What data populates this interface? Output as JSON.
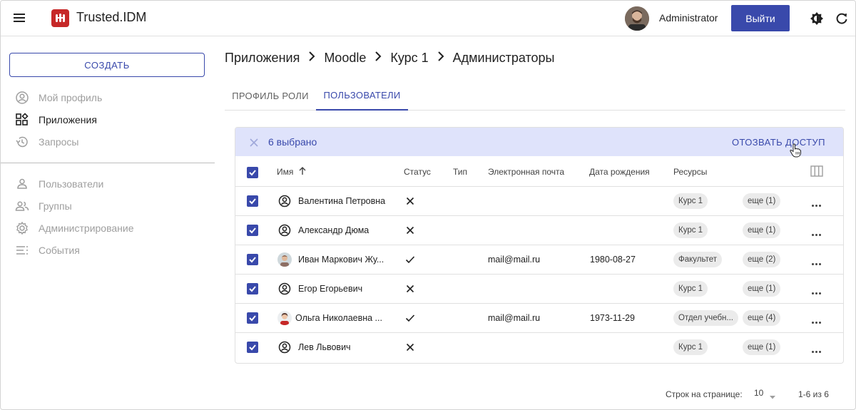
{
  "header": {
    "app_title": "Trusted.IDM",
    "user_name": "Administrator",
    "logout_label": "Выйти"
  },
  "sidebar": {
    "create_label": "СОЗДАТЬ",
    "items": [
      {
        "label": "Мой профиль",
        "icon": "account-circle-icon"
      },
      {
        "label": "Приложения",
        "icon": "apps-icon"
      },
      {
        "label": "Запросы",
        "icon": "history-icon"
      },
      {
        "label": "Пользователи",
        "icon": "person-icon"
      },
      {
        "label": "Группы",
        "icon": "group-icon"
      },
      {
        "label": "Администрирование",
        "icon": "gear-icon"
      },
      {
        "label": "События",
        "icon": "list-icon"
      }
    ]
  },
  "breadcrumb": [
    "Приложения",
    "Moodle",
    "Курс 1",
    "Администраторы"
  ],
  "tabs": [
    {
      "label": "ПРОФИЛЬ РОЛИ",
      "active": false
    },
    {
      "label": "ПОЛЬЗОВАТЕЛИ",
      "active": true
    }
  ],
  "selection": {
    "count_text": "6 выбрано",
    "revoke_label": "ОТОЗВАТЬ ДОСТУП"
  },
  "table": {
    "columns": [
      "Имя",
      "Статус",
      "Тип",
      "Электронная почта",
      "Дата рождения",
      "Ресурсы"
    ],
    "rows": [
      {
        "name": "Валентина Петровна",
        "avatar": "user-outline",
        "status": "inactive",
        "email": "",
        "birth": "",
        "resource": "Курс 1",
        "more": "еще (1)"
      },
      {
        "name": "Александр Дюма",
        "avatar": "user-outline",
        "status": "inactive",
        "email": "",
        "birth": "",
        "resource": "Курс 1",
        "more": "еще (1)"
      },
      {
        "name": "Иван Маркович Жу...",
        "avatar": "photo",
        "status": "active",
        "email": "mail@mail.ru",
        "birth": "1980-08-27",
        "resource": "Факультет",
        "more": "еще (2)"
      },
      {
        "name": "Егор Егорьевич",
        "avatar": "user-outline",
        "status": "inactive",
        "email": "",
        "birth": "",
        "resource": "Курс 1",
        "more": "еще (1)"
      },
      {
        "name": "Ольга Николаевна ...",
        "avatar": "photo",
        "status": "active",
        "email": "mail@mail.ru",
        "birth": "1973-11-29",
        "resource": "Отдел учебн...",
        "more": "еще (4)"
      },
      {
        "name": "Лев Львович",
        "avatar": "user-outline",
        "status": "inactive",
        "email": "",
        "birth": "",
        "resource": "Курс 1",
        "more": "еще (1)"
      }
    ]
  },
  "pagination": {
    "rows_per_page_label": "Строк на странице:",
    "rows_per_page_value": "10",
    "range_text": "1-6 из 6"
  },
  "colors": {
    "accent": "#3949ab",
    "selection_bar": "#dfe3fb",
    "logo": "#c62828"
  }
}
